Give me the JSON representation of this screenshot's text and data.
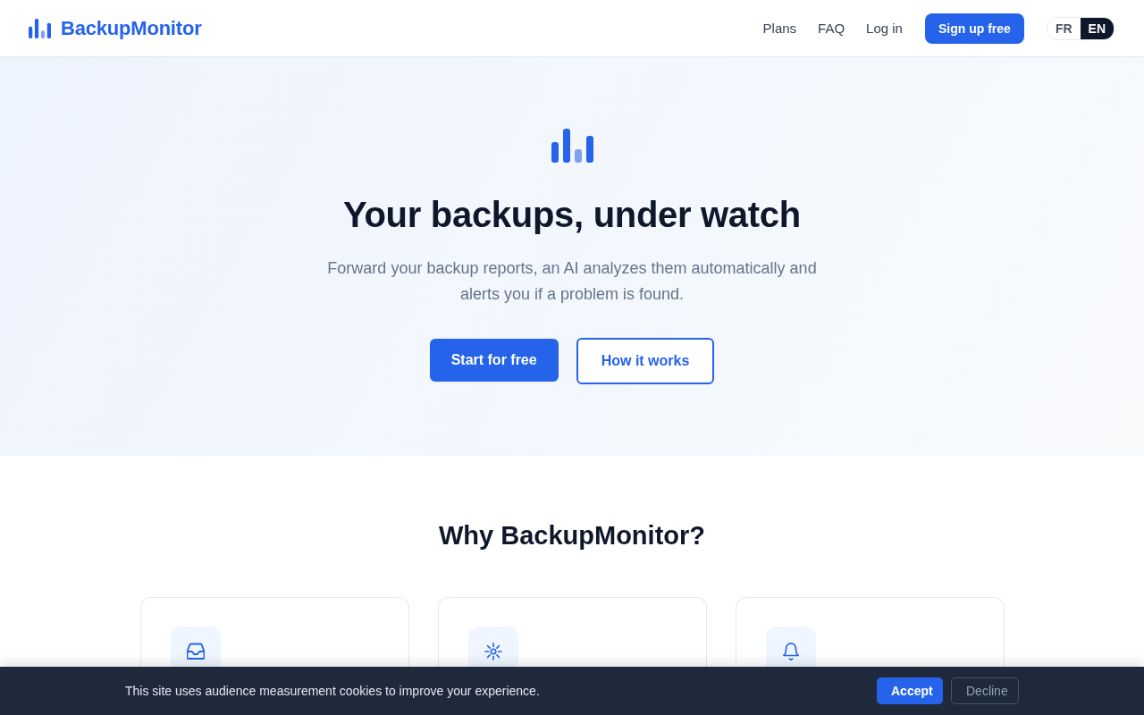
{
  "header": {
    "logo": "BackupMonitor",
    "nav": [
      "Plans",
      "FAQ",
      "Log in"
    ],
    "signup_button": "Sign up free",
    "languages": [
      {
        "label": "FR",
        "selected": false
      },
      {
        "label": "EN",
        "selected": true
      }
    ]
  },
  "hero": {
    "title": "Your backups, under watch",
    "subtitle": "Forward your backup reports, an AI analyzes them automatically and alerts you if a problem is found.",
    "buttons": [
      {
        "label": "Start for free",
        "kind": "primary"
      },
      {
        "label": "How it works",
        "kind": "outline"
      }
    ]
  },
  "features": {
    "title": "Why BackupMonitor?",
    "cards": [
      {
        "kind": "inbox"
      },
      {
        "kind": "sun"
      },
      {
        "kind": "bell"
      }
    ]
  },
  "cookie_banner": {
    "text": "This site uses audience measurement cookies to improve your experience.",
    "buttons": [
      {
        "label": "Accept",
        "kind": "primary"
      },
      {
        "label": "Decline",
        "kind": "secondary"
      }
    ]
  }
}
